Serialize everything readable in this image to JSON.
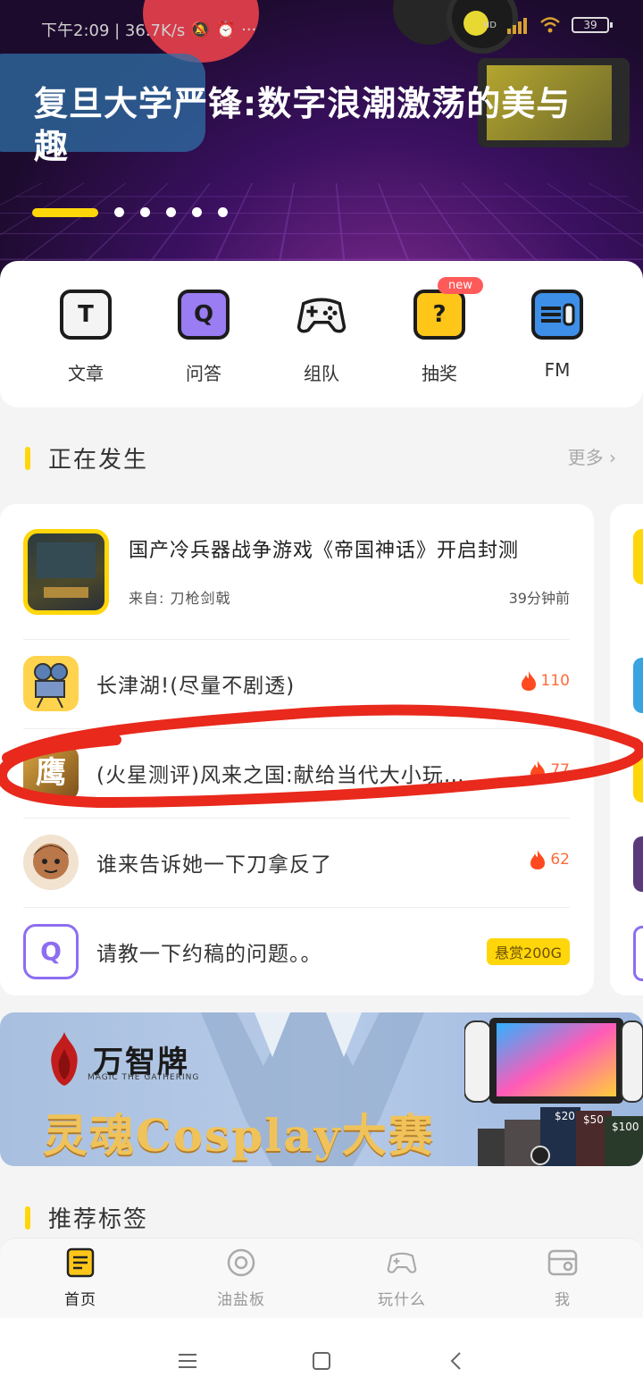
{
  "status_bar": {
    "time_speed": "下午2:09 | 36.7K/s",
    "hd": "HD",
    "battery": "39"
  },
  "hero": {
    "title": "复旦大学严锋:数字浪潮激荡的美与趣"
  },
  "quick_menu": [
    {
      "label": "文章",
      "icon": "article-icon",
      "glyph": "T"
    },
    {
      "label": "问答",
      "icon": "qa-icon",
      "glyph": "Q"
    },
    {
      "label": "组队",
      "icon": "gamepad-icon",
      "glyph": ""
    },
    {
      "label": "抽奖",
      "icon": "lottery-icon",
      "glyph": "?",
      "badge": "new"
    },
    {
      "label": "FM",
      "icon": "radio-icon",
      "glyph": ""
    }
  ],
  "happening": {
    "title": "正在发生",
    "more": "更多",
    "featured": {
      "title": "国产冷兵器战争游戏《帝国神话》开启封测",
      "from": "来自: 刀枪剑戟",
      "time": "39分钟前"
    },
    "items": [
      {
        "title": "长津湖!(尽量不剧透)",
        "hot": "110"
      },
      {
        "title": "(火星测评)风来之国:献给当代大小玩…",
        "hot": "77"
      },
      {
        "title": "谁来告诉她一下刀拿反了",
        "hot": "62"
      },
      {
        "title": "请教一下约稿的问题。。",
        "reward": "悬赏200G"
      }
    ]
  },
  "banner": {
    "brand": "万智牌",
    "brand_sub": "MAGIC THE GATHERING",
    "title": "灵魂Cosplay大赛",
    "card_values": [
      "$20",
      "$50",
      "$100"
    ]
  },
  "recommend": {
    "title": "推荐标签"
  },
  "tabbar": [
    {
      "label": "首页",
      "active": true
    },
    {
      "label": "油盐板",
      "active": false
    },
    {
      "label": "玩什么",
      "active": false
    },
    {
      "label": "我",
      "active": false
    }
  ]
}
